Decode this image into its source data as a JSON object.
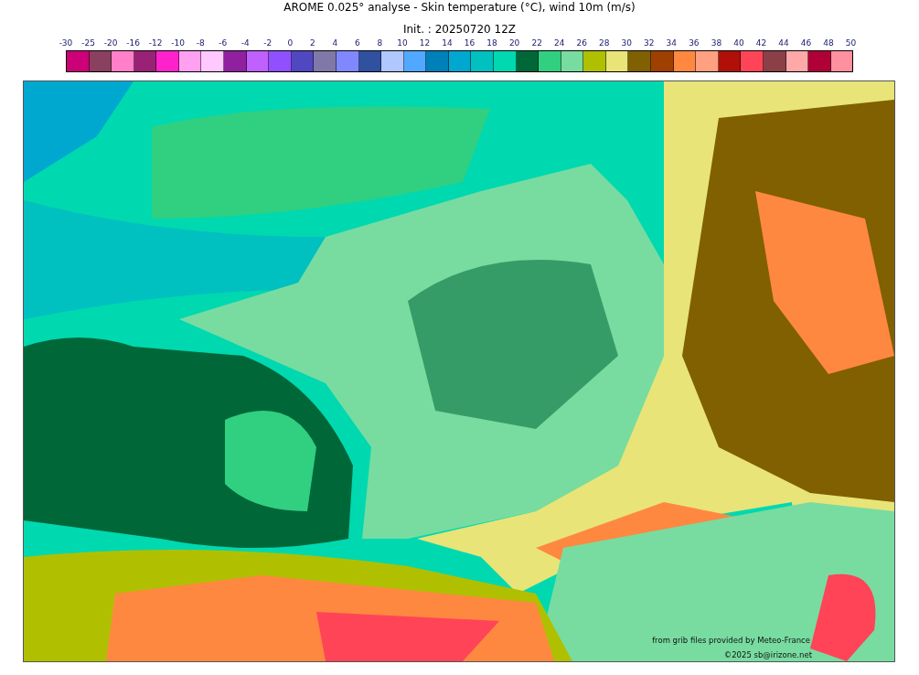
{
  "title": "AROME 0.025° analyse - Skin temperature (°C), wind 10m (m/s)",
  "subtitle": "Init. : 20250720 12Z",
  "legend": {
    "ticks": [
      "-30",
      "-25",
      "-20",
      "-16",
      "-12",
      "-10",
      "-8",
      "-6",
      "-4",
      "-2",
      "0",
      "2",
      "4",
      "6",
      "8",
      "10",
      "12",
      "14",
      "16",
      "18",
      "20",
      "22",
      "24",
      "26",
      "28",
      "30",
      "32",
      "34",
      "36",
      "38",
      "40",
      "42",
      "44",
      "46",
      "48",
      "50"
    ],
    "bins": [
      {
        "color": "#cc0077"
      },
      {
        "color": "#8b4060"
      },
      {
        "color": "#ff80c8"
      },
      {
        "color": "#992277"
      },
      {
        "color": "#ff22cc"
      },
      {
        "color": "#ffa0f0"
      },
      {
        "color": "#ffc8ff"
      },
      {
        "color": "#9020a0"
      },
      {
        "color": "#c060ff"
      },
      {
        "color": "#9050ff"
      },
      {
        "color": "#5048c0"
      },
      {
        "color": "#8078a8"
      },
      {
        "color": "#8088ff"
      },
      {
        "color": "#3050a0"
      },
      {
        "color": "#b0c8ff"
      },
      {
        "color": "#50a8ff"
      },
      {
        "color": "#0080b8"
      },
      {
        "color": "#00a8d0"
      },
      {
        "color": "#00c0c0"
      },
      {
        "color": "#00d8b0"
      },
      {
        "color": "#006838"
      },
      {
        "color": "#30d080"
      },
      {
        "color": "#78dca0"
      },
      {
        "color": "#b0c000"
      },
      {
        "color": "#e8e478"
      },
      {
        "color": "#806000"
      },
      {
        "color": "#a04000"
      },
      {
        "color": "#ff8840"
      },
      {
        "color": "#ffa080"
      },
      {
        "color": "#b01008"
      },
      {
        "color": "#ff4458"
      },
      {
        "color": "#8b4048"
      },
      {
        "color": "#ffa8a8"
      },
      {
        "color": "#b00038"
      },
      {
        "color": "#ff90a0"
      }
    ]
  },
  "map": {
    "credits": [
      "from grib files provided by Meteo-France",
      "©2025 sb@irizone.net"
    ]
  }
}
